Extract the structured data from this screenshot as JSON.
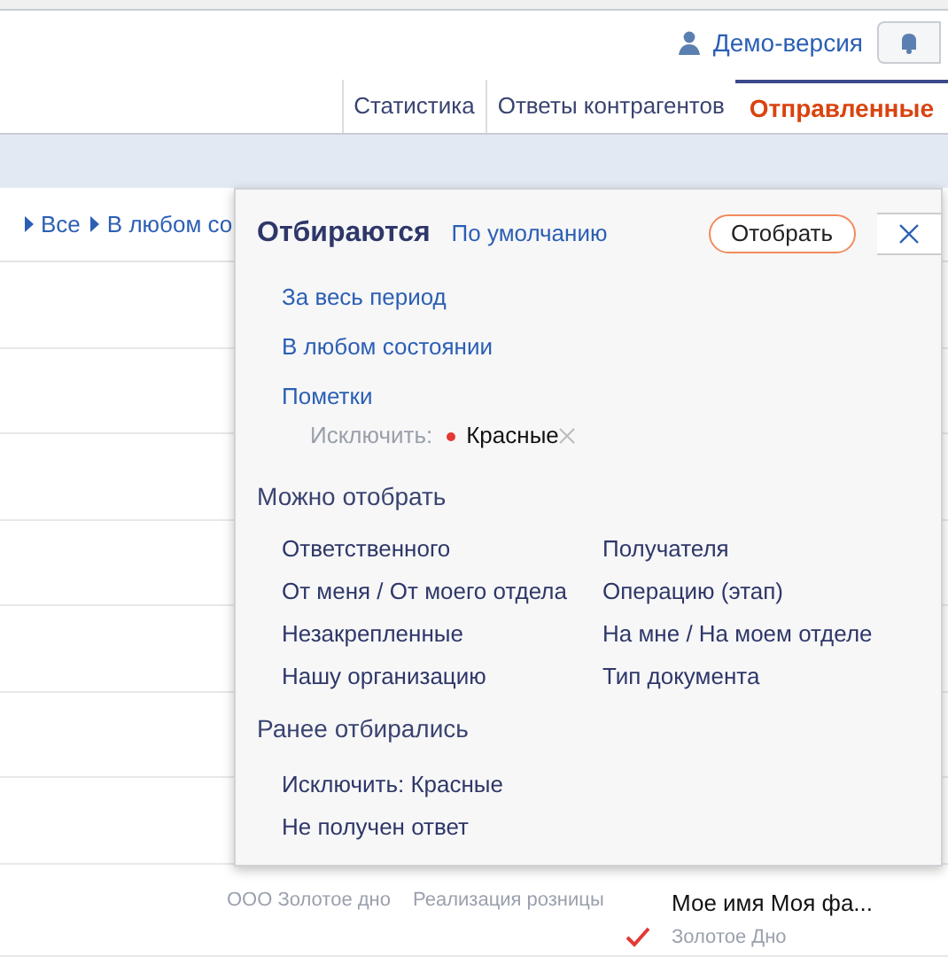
{
  "header": {
    "user": "Демо-версия"
  },
  "tabs": [
    {
      "label": "Статистика",
      "selected": false
    },
    {
      "label": "Ответы контрагентов",
      "selected": false
    },
    {
      "label": "Отправленные",
      "selected": true
    }
  ],
  "breadcrumb": [
    "Все",
    "В любом со"
  ],
  "last_row": {
    "organization": "ООО Золотое дно",
    "operation": "Реализация розницы",
    "name": "Мое имя Моя фа...",
    "company": "Золотое Дно",
    "checked": true
  },
  "filter_panel": {
    "title": "Отбираются",
    "default_link": "По умолчанию",
    "apply_button": "Отобрать",
    "active_filters": [
      {
        "label": "За весь период"
      },
      {
        "label": "В любом состоянии"
      },
      {
        "label": "Пометки",
        "exclude_label": "Исключить:",
        "exclude_value": "Красные",
        "color": "#e53935"
      }
    ],
    "available_heading": "Можно отобрать",
    "available": [
      "Ответственного",
      "Получателя",
      "От меня / От моего отдела",
      "Операцию (этап)",
      "Незакрепленные",
      "На мне / На моем отделе",
      "Нашу организацию",
      "Тип документа"
    ],
    "history_heading": "Ранее отбирались",
    "history": [
      "Исключить: Красные",
      "Не получен ответ"
    ]
  }
}
